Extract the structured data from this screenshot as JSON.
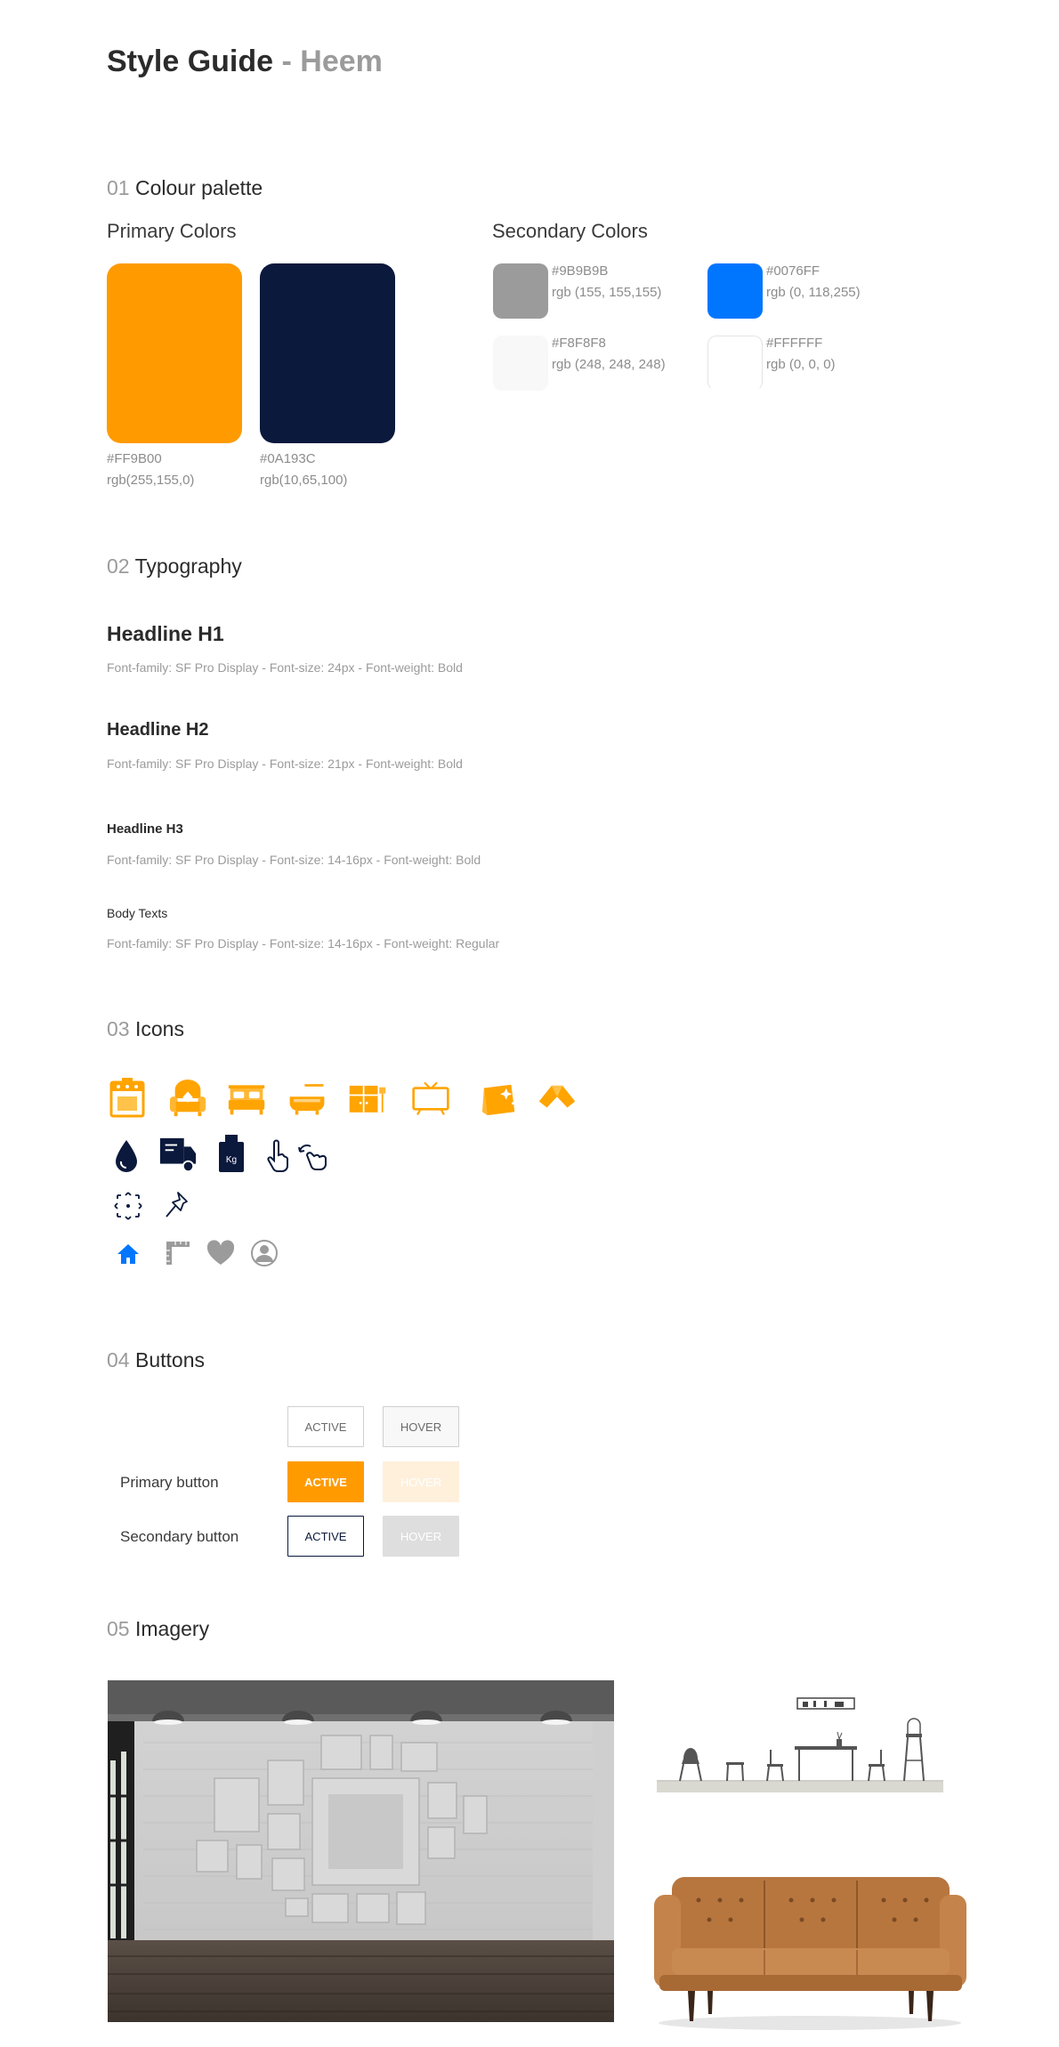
{
  "header": {
    "title": "Style Guide",
    "separator": " - ",
    "subtitle": "Heem"
  },
  "palette": {
    "num": "01",
    "title": "Colour palette",
    "primary_heading": "Primary Colors",
    "secondary_heading": "Secondary Colors",
    "primary": [
      {
        "hex": "#FF9B00",
        "rgb": "rgb(255,155,0)",
        "color": "#FF9B00"
      },
      {
        "hex": "#0A193C",
        "rgb": "rgb(10,65,100)",
        "color": "#0A193C"
      }
    ],
    "secondary": [
      {
        "hex": "#9B9B9B",
        "rgb": "rgb (155, 155,155)",
        "color": "#9B9B9B"
      },
      {
        "hex": "#0076FF",
        "rgb": "rgb (0, 118,255)",
        "color": "#0076FF"
      },
      {
        "hex": "#F8F8F8",
        "rgb": "rgb (248, 248, 248)",
        "color": "#F8F8F8"
      },
      {
        "hex": "#FFFFFF",
        "rgb": "rgb (0, 0, 0)",
        "color": "#FFFFFF"
      }
    ]
  },
  "typography": {
    "num": "02",
    "title": "Typography",
    "items": [
      {
        "label": "Headline H1",
        "desc": "Font-family: SF Pro Display  -  Font-size: 24px  -  Font-weight: Bold"
      },
      {
        "label": "Headline H2",
        "desc": "Font-family: SF Pro Display  -  Font-size: 21px  -  Font-weight: Bold"
      },
      {
        "label": "Headline H3",
        "desc": "Font-family: SF Pro Display  -  Font-size: 14-16px  -  Font-weight: Bold"
      },
      {
        "label": "Body Texts",
        "desc": "Font-family: SF Pro Display  -  Font-size: 14-16px  -  Font-weight: Regular"
      }
    ]
  },
  "icons": {
    "num": "03",
    "title": "Icons",
    "kg_label": "Kg",
    "row1": [
      "stove-icon",
      "armchair-icon",
      "bed-icon",
      "bathtub-icon",
      "cabinet-icon",
      "tv-icon",
      "box-sparkle-icon",
      "cloth-icon"
    ],
    "row2": [
      "water-drop-icon",
      "delivery-truck-icon",
      "weight-kg-icon",
      "tap-hand-icon",
      "swipe-hand-icon"
    ],
    "row3": [
      "move-arrows-icon",
      "pin-icon"
    ],
    "row4": [
      "home-icon",
      "ruler-icon",
      "heart-icon",
      "user-icon"
    ]
  },
  "buttons": {
    "num": "04",
    "title": "Buttons",
    "active_label": "ACTIVE",
    "hover_label": "HOVER",
    "primary_label": "Primary button",
    "secondary_label": "Secondary button"
  },
  "imagery": {
    "num": "05",
    "title": "Imagery",
    "images": [
      "gallery-wall-room",
      "dining-furniture-line",
      "leather-sofa"
    ]
  }
}
